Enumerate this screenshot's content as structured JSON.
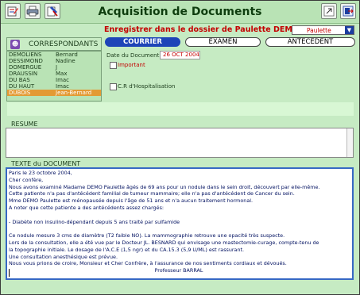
{
  "window": {
    "title": "Acquisition de Documents",
    "record_label": "Enregistrer dans le dossier de Paulette DEMO",
    "patient_select": "Paulette"
  },
  "correspondants": {
    "title": "CORRESPONDANTS",
    "rows": [
      {
        "last": "DEMOLIENS",
        "first": "Bernard",
        "selected": false
      },
      {
        "last": "DESSIMOND",
        "first": "Nadine",
        "selected": false
      },
      {
        "last": "DOMERGUE",
        "first": "J",
        "selected": false
      },
      {
        "last": "DRAUSSIN",
        "first": "Max",
        "selected": false
      },
      {
        "last": "DU BAS",
        "first": "Imac",
        "selected": false
      },
      {
        "last": "DU HAUT",
        "first": "Imac",
        "selected": false
      },
      {
        "last": "DUBOIS",
        "first": "Jean-Bernard",
        "selected": true
      }
    ]
  },
  "tabs": [
    {
      "label": "COURRIER",
      "active": true
    },
    {
      "label": "EXAMEN",
      "active": false
    },
    {
      "label": "ANTECEDENT",
      "active": false
    }
  ],
  "form": {
    "date_label": "Date du Document",
    "date_value": "26 OCT 2004",
    "important_label": "Important",
    "hospitalisation_label": "C.R d'Hospitalisation"
  },
  "resume": {
    "label": "RESUME",
    "text": ""
  },
  "document": {
    "label": "TEXTE du DOCUMENT",
    "lines": [
      "Paris le 23 octobre 2004,",
      "Cher confère,",
      "Nous avons examiné Madame DEMO Paulette âgés de 69 ans pour un nodule dans le sein droit, découvert par elle-même.",
      "Cette patiente n'a pas d'antécédent familial de tumeur mammaire; elle n'a pas d'antécédent de Cancer du sein.",
      "Mme DEMO Paulette est ménopausée depuis l'âge de 51 ans et n'a aucun traitement hormonal.",
      "A noter que cette patiente a des antécédents assez chargés:",
      "",
      "- Diabète non insulino-dépendant depuis 5 ans traité par sulfamide",
      "",
      "Ce nodule mesure 3 cms de diamètre (T2 faible NO). La mammographie retrouve une opacité très suspecte.",
      "Lors de la consultation, elle a été vue par le Docteur JL. BESNARD qui envisage une mastectomie-curage, compte-tenu de",
      "la topographie initiale. Le dosage de l'A.C.E (1,5 ngr) et du CA.15.3 (5,9 U/ML) est rassurant.",
      "Une consultation anesthésique est prévue.",
      "Nous vous prions de croire, Monsieur et Cher Confrère, à l'assurance de nos sentiments cordiaux et dévoués.",
      "Professeur BARRAL"
    ]
  }
}
